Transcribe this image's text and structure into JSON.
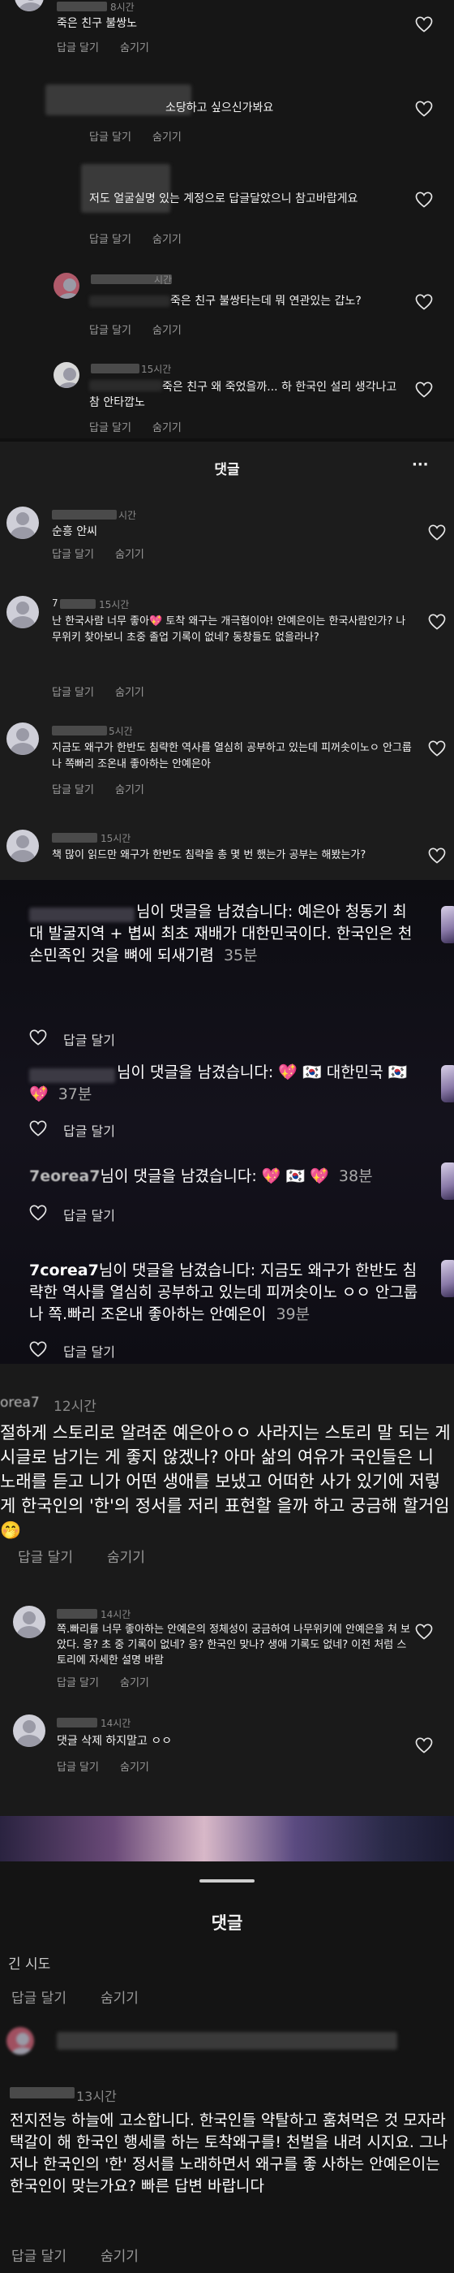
{
  "thread1": {
    "comments": [
      {
        "time": "8시간",
        "text": "죽은 친구 불쌍노",
        "reply": "답글 달기",
        "hide": "숨기기"
      },
      {
        "time": "",
        "text": "소당하고 싶으신가봐요",
        "reply": "답글 달기",
        "hide": "숨기기"
      },
      {
        "time": "",
        "text": "저도 얼굴실명 있는 계정으로 답글달았으니 참고바랍게요",
        "reply": "답글 달기",
        "hide": "숨기기"
      },
      {
        "time": "시간",
        "text": "죽은 친구 불쌍타는데 뭐 연관있는 갑노?",
        "reply": "답글 달기",
        "hide": "숨기기"
      },
      {
        "time": "15시간",
        "text": "죽은 친구 왜 죽었을까... 하 한국인 설리 생각나고 참 안타깝노",
        "reply": "답글 달기",
        "hide": "숨기기"
      }
    ]
  },
  "panel2": {
    "title": "댓글",
    "more": "···",
    "comments": [
      {
        "name": "",
        "time": "시간",
        "text": "순흥 안씨",
        "reply": "답글 달기",
        "hide": "숨기기"
      },
      {
        "name": "7",
        "time": "15시간",
        "text": "난 한국사람 너무 좋아💖 토착 왜구는 개극혐이야! 안예은이는 한국사람인가? 나무위키 찾아보니 초중 졸업 기록이 없네? 동창들도 없을라나?",
        "reply": "답글 달기",
        "hide": "숨기기"
      },
      {
        "name": "",
        "time": "5시간",
        "text": "지금도 왜구가 한반도 침략한 역사를 열심히 공부하고 있는데 피꺼솟이노ㅇ 안그룹나 쪽빠리 조온내 좋아하는 안예은아",
        "reply": "답글 달기",
        "hide": "숨기기"
      },
      {
        "name": "",
        "time": "15시간",
        "text": "책 많이 읽드만 왜구가 한반도 침략을 총 몇 번 했는가 공부는 해봤는가?",
        "reply": "답글 달기",
        "hide": "숨기기"
      }
    ]
  },
  "notifications": {
    "items": [
      {
        "name": "",
        "text": "님이 댓글을 남겼습니다: 예은아 청동기 최대 발굴지역 + 볍씨 최초 재배가 대한민국이다. 한국인은 천손민족인 것을 뼈에 되새기렴",
        "time": "35분",
        "reply": "답글 달기"
      },
      {
        "name": "",
        "text": "님이 댓글을 남겼습니다: 💖 🇰🇷 대한민국 🇰🇷 💖",
        "time": "37분",
        "reply": "답글 달기"
      },
      {
        "name": "7eorea7",
        "text": "님이 댓글을 남겼습니다: 💖 🇰🇷 💖",
        "time": "38분",
        "reply": "답글 달기"
      },
      {
        "name": "7corea7",
        "text": "님이 댓글을 남겼습니다: 지금도 왜구가 한반도 침략한 역사를 열심히 공부하고 있는데 피꺼솟이노 ㅇㅇ 안그룹나 쪽.빠리 조온내 좋아하는 안예은이",
        "time": "39분",
        "reply": "답글 달기"
      }
    ]
  },
  "thread4": {
    "main": {
      "name": "orea7",
      "time": "12시간",
      "text": "절하게 스토리로 알려준 예은아ㅇㅇ 사라지는 스토리 말 되는 게시글로 남기는 게 좋지 않겠나? 아마 삶의 여유가 국인들은 니 노래를 듣고 니가 어떤 생애를 보냈고 어떠한 사가 있기에 저렇게 한국인의 '한'의 정서를 저리 표현할 을까 하고 궁금해 할거임🤭",
      "reply": "답글 달기",
      "hide": "숨기기"
    },
    "replies": [
      {
        "time": "14시간",
        "text": "쪽.빠리를 너무 좋아하는 안예은의 정체성이 궁금하여 나무위키에 안예은을 쳐 보았다. 응? 초 중 기록이 없네? 응? 한국인 맞나? 생애 기록도 없네? 이전 처럼 스토리에 자세한 설명 바람",
        "reply": "답글 달기",
        "hide": "숨기기"
      },
      {
        "time": "14시간",
        "text": "댓글 삭제 하지말고 ㅇㅇ",
        "reply": "답글 달기",
        "hide": "숨기기"
      }
    ]
  },
  "panel5": {
    "title": "댓글",
    "partial_text": "긴 시도",
    "top_reply": "답글 달기",
    "top_hide": "숨기기",
    "comment": {
      "time": "13시간",
      "text": "전지전능 하늘에 고소합니다. 한국인들 약탈하고 훔쳐먹은 것 모자라 택갈이 해 한국인 행세를 하는 토착왜구를! 천벌을 내려 시지요. 그나저나 한국인의 '한' 정서를 노래하면서 왜구를 좋 사하는 안예은이는 한국인이 맞는가요? 빠른 답변 바랍니다",
      "reply": "답글 달기",
      "hide": "숨기기"
    }
  }
}
